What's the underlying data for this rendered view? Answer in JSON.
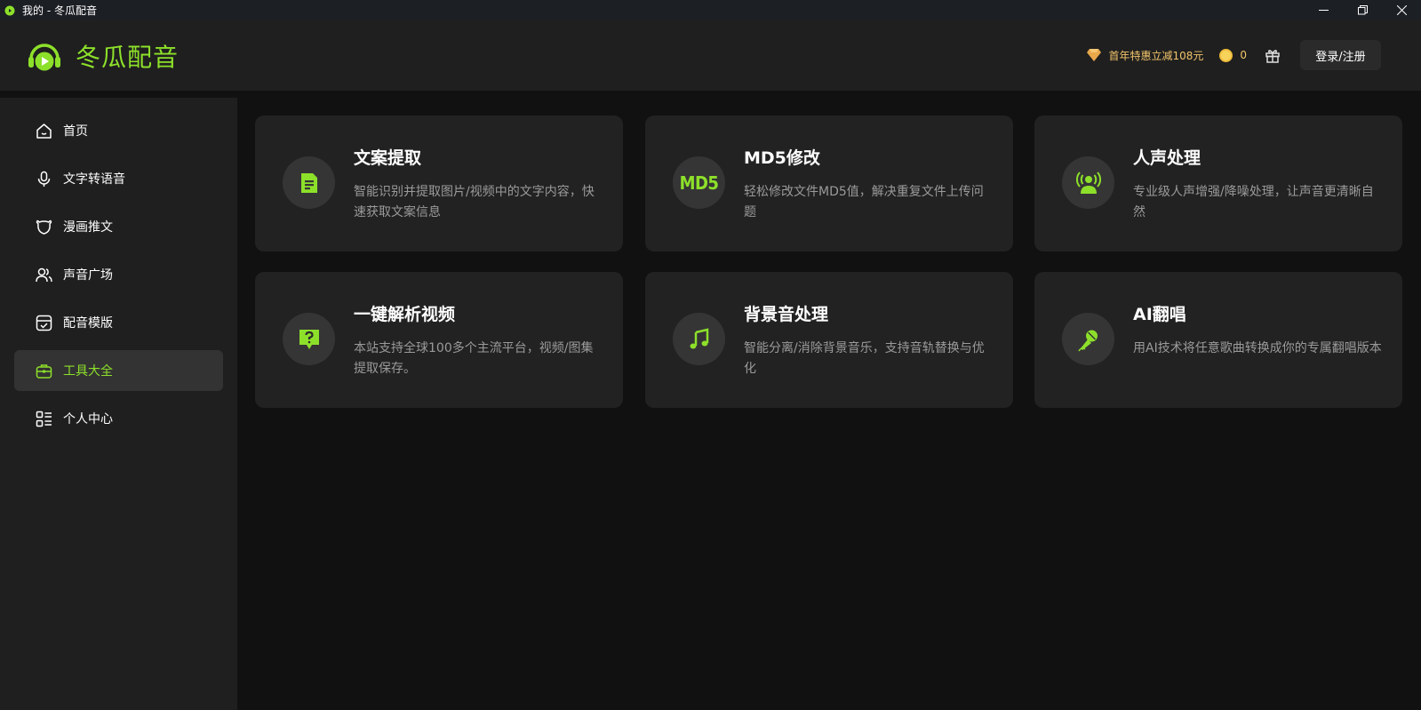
{
  "window": {
    "title": "我的 - 冬瓜配音"
  },
  "brand": {
    "name": "冬瓜配音",
    "accent": "#8de02a"
  },
  "header": {
    "promo_text": "首年特惠立减108元",
    "coin_count": "0",
    "login_label": "登录/注册"
  },
  "sidebar": {
    "items": [
      {
        "label": "首页",
        "icon": "home-icon"
      },
      {
        "label": "文字转语音",
        "icon": "microphone-icon"
      },
      {
        "label": "漫画推文",
        "icon": "bear-icon"
      },
      {
        "label": "声音广场",
        "icon": "people-icon"
      },
      {
        "label": "配音模版",
        "icon": "template-icon"
      },
      {
        "label": "工具大全",
        "icon": "toolbox-icon",
        "active": true
      },
      {
        "label": "个人中心",
        "icon": "profile-list-icon"
      }
    ]
  },
  "tools": [
    {
      "title": "文案提取",
      "desc": "智能识别并提取图片/视频中的文字内容，快速获取文案信息",
      "icon": "document-icon"
    },
    {
      "title": "MD5修改",
      "desc": "轻松修改文件MD5值，解决重复文件上传问题",
      "icon": "md5-icon",
      "badge": "MD5"
    },
    {
      "title": "人声处理",
      "desc": "专业级人声增强/降噪处理，让声音更清晰自然",
      "icon": "voice-broadcast-icon"
    },
    {
      "title": "一键解析视频",
      "desc": "本站支持全球100多个主流平台，视频/图集提取保存。",
      "icon": "question-chat-icon"
    },
    {
      "title": "背景音处理",
      "desc": "智能分离/消除背景音乐，支持音轨替换与优化",
      "icon": "music-note-icon"
    },
    {
      "title": "AI翻唱",
      "desc": "用AI技术将任意歌曲转换成你的专属翻唱版本",
      "icon": "microphone-sing-icon"
    }
  ]
}
